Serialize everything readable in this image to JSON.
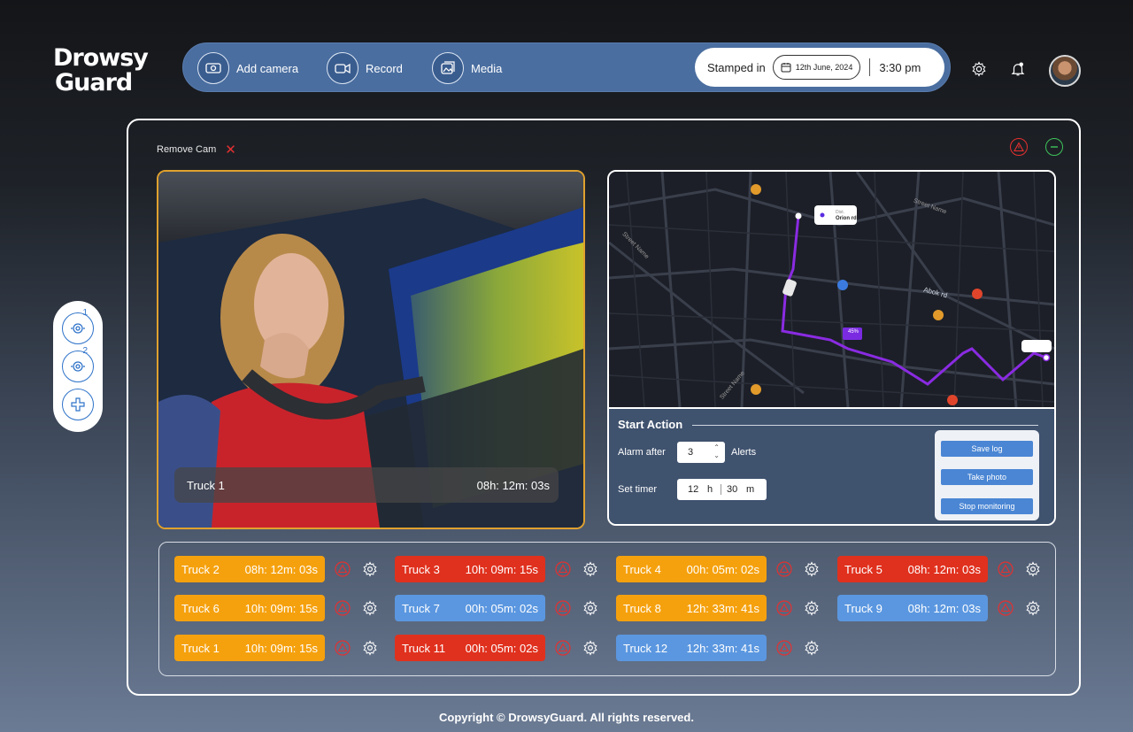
{
  "brand": {
    "line1": "Drowsy",
    "line2": "Guard"
  },
  "nav": {
    "add_camera": "Add camera",
    "record": "Record",
    "media": "Media"
  },
  "stamp": {
    "label": "Stamped in",
    "date": "12th June, 2024",
    "time": "3:30 pm"
  },
  "main": {
    "remove_cam": "Remove Cam",
    "video": {
      "truck": "Truck 1",
      "duration": "08h: 12m: 03s"
    },
    "side_cams": [
      "1",
      "2"
    ]
  },
  "map": {
    "street_top": "Street Name",
    "street_left": "Street Name",
    "street_bottom": "Street Name",
    "road": "Abok rd",
    "popup_small": "Dist.",
    "popup_big": "Orion rd",
    "percent": "45%"
  },
  "actions": {
    "title": "Start Action",
    "alarm_label": "Alarm after",
    "alarm_value": "3",
    "alarm_unit": "Alerts",
    "timer_label": "Set timer",
    "timer_h": "12",
    "timer_h_unit": "h",
    "timer_m": "30",
    "timer_m_unit": "m",
    "save_log": "Save log",
    "take_photo": "Take photo",
    "stop_monitoring": "Stop monitoring"
  },
  "trucks": [
    {
      "name": "Truck 2",
      "time": "08h: 12m: 03s",
      "status": "orange"
    },
    {
      "name": "Truck 3",
      "time": "10h: 09m: 15s",
      "status": "red"
    },
    {
      "name": "Truck 4",
      "time": "00h: 05m: 02s",
      "status": "orange"
    },
    {
      "name": "Truck 5",
      "time": "08h: 12m: 03s",
      "status": "red"
    },
    {
      "name": "Truck 6",
      "time": "10h: 09m: 15s",
      "status": "orange"
    },
    {
      "name": "Truck 7",
      "time": "00h: 05m: 02s",
      "status": "blue"
    },
    {
      "name": "Truck 8",
      "time": "12h: 33m: 41s",
      "status": "orange"
    },
    {
      "name": "Truck 9",
      "time": "08h: 12m: 03s",
      "status": "blue"
    },
    {
      "name": "Truck 1",
      "time": "10h: 09m: 15s",
      "status": "orange"
    },
    {
      "name": "Truck 11",
      "time": "00h: 05m: 02s",
      "status": "red"
    },
    {
      "name": "Truck 12",
      "time": "12h: 33m: 41s",
      "status": "blue"
    }
  ],
  "colors": {
    "orange": "#f5a10e",
    "red": "#e0311e",
    "blue": "#5b97e0",
    "accent_frame": "#e0a12e"
  },
  "footer": "Copyright © DrowsyGuard.  All rights reserved."
}
